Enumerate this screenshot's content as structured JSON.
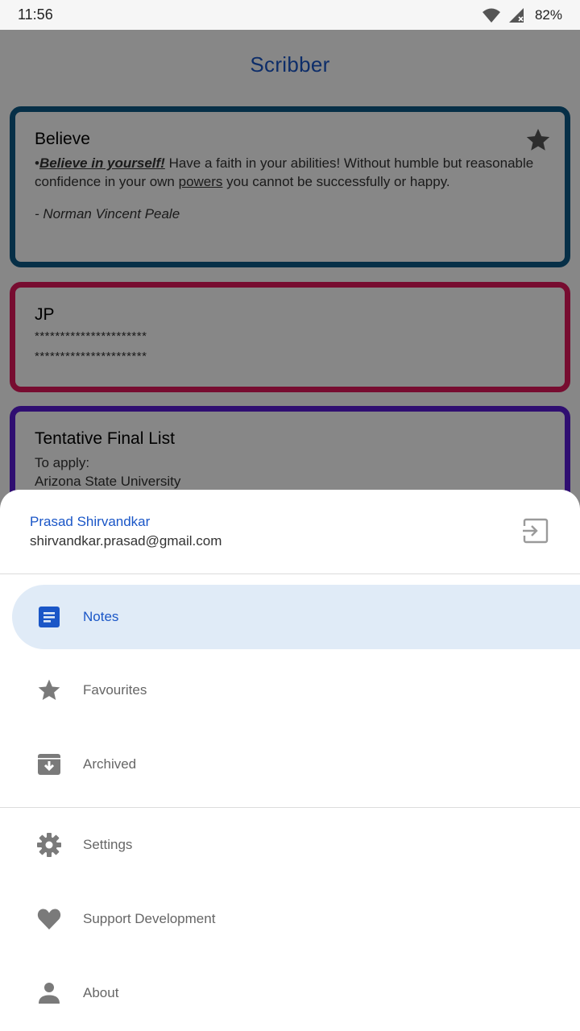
{
  "status_bar": {
    "time": "11:56",
    "battery": "82%"
  },
  "app": {
    "title": "Scribber"
  },
  "notes": [
    {
      "title": "Believe",
      "line_bullet": "•",
      "line_emph": "Believe in yourself!",
      "line_text": " Have a faith in your abilities! Without humble but reasonable confidence in your own ",
      "line_link": "powers",
      "line_tail": " you cannot be successfully or happy.",
      "signature": "- Norman Vincent Peale"
    },
    {
      "title": "JP",
      "line1": "**********************",
      "line2": "**********************"
    },
    {
      "title": "Tentative Final List",
      "line1": "To apply:",
      "line2": "Arizona State University"
    }
  ],
  "drawer": {
    "account_name": "Prasad Shirvandkar",
    "account_email": "shirvandkar.prasad@gmail.com",
    "items": [
      {
        "label": "Notes",
        "icon": "notes-icon",
        "selected": true
      },
      {
        "label": "Favourites",
        "icon": "star-icon"
      },
      {
        "label": "Archived",
        "icon": "archive-icon"
      },
      {
        "label": "Settings",
        "icon": "gear-icon"
      },
      {
        "label": "Support Development",
        "icon": "heart-icon"
      },
      {
        "label": "About",
        "icon": "person-icon"
      }
    ]
  },
  "colors": {
    "accent": "#1a56c7",
    "selected_bg": "#e0ebf7",
    "icon_gray": "#7a7a7a",
    "card_border_1": "#0d5a86",
    "card_border_2": "#e0185c",
    "card_border_3": "#5a1bd6"
  }
}
